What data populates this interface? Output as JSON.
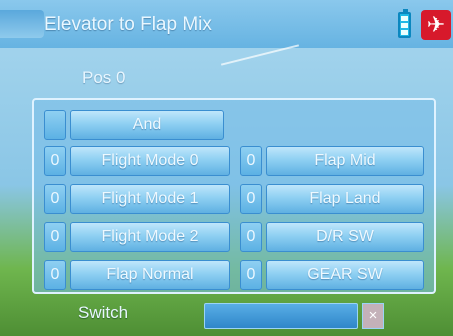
{
  "header": {
    "title": "Elevator to Flap Mix",
    "battery_icon": "battery-icon",
    "model_icon": "helicopter-icon"
  },
  "position": {
    "label": "Pos 0"
  },
  "panel": {
    "and_row": {
      "index": "",
      "label": "And"
    },
    "left_column": [
      {
        "index": "0",
        "label": "Flight Mode 0"
      },
      {
        "index": "0",
        "label": "Flight Mode 1"
      },
      {
        "index": "0",
        "label": "Flight Mode 2"
      },
      {
        "index": "0",
        "label": "Flap Normal"
      }
    ],
    "right_column": [
      {
        "index": "0",
        "label": "Flap Mid"
      },
      {
        "index": "0",
        "label": "Flap Land"
      },
      {
        "index": "0",
        "label": "D/R SW"
      },
      {
        "index": "0",
        "label": "GEAR SW"
      }
    ]
  },
  "footer": {
    "switch_label": "Switch",
    "switch_value": "",
    "clear_glyph": "×"
  },
  "colors": {
    "button_blue": "#8fd0f2",
    "header_blue": "#66b3e2",
    "model_icon_red": "#d7192b"
  }
}
